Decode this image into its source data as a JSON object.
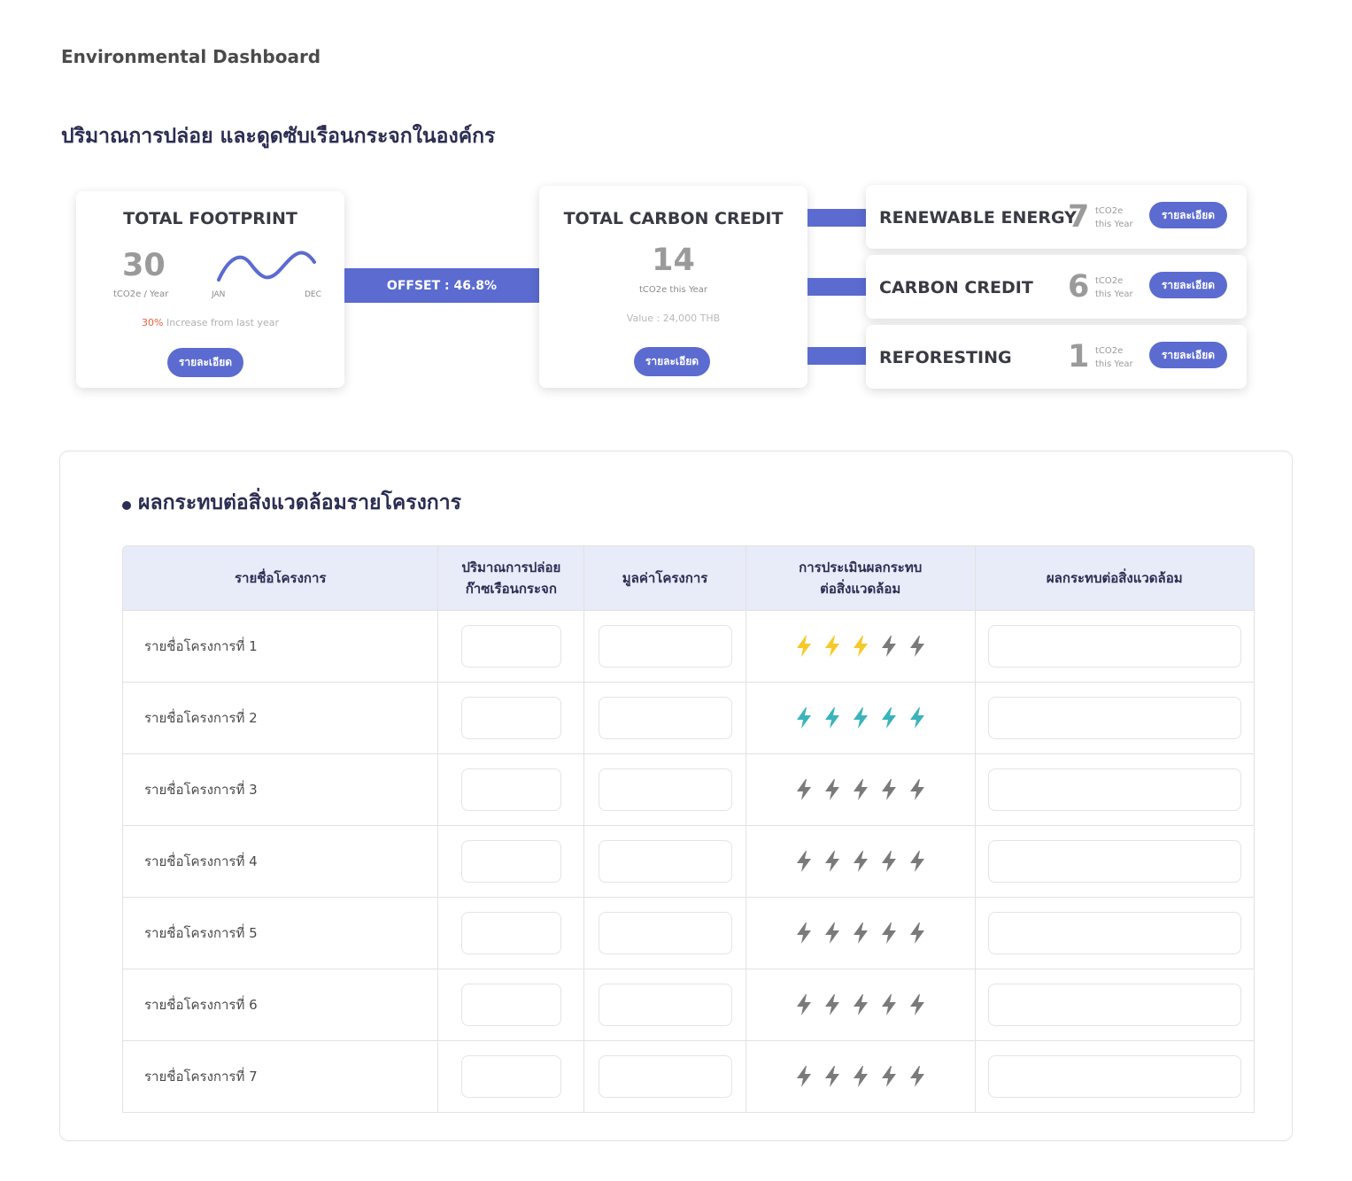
{
  "header": {
    "app_title": "Environmental Dashboard",
    "section_title": "ปริมาณการปล่อย และดูดซับเรือนกระจกในองค์กร"
  },
  "footprint": {
    "title": "TOTAL FOOTPRINT",
    "value": "30",
    "unit": "tCO2e / Year",
    "jan": "JAN",
    "dec": "DEC",
    "increase_pct": "30%",
    "increase_text": " Increase from last year",
    "button": "รายละเอียด"
  },
  "offset": {
    "label": "OFFSET : 46.8%"
  },
  "credit": {
    "title": "TOTAL CARBON CREDIT",
    "value": "14",
    "unit": "tCO2e this Year",
    "value_text": "Value : 24,000 THB",
    "button": "รายละเอียด"
  },
  "breakdown": [
    {
      "label": "RENEWABLE ENERGY",
      "value": "7",
      "unit_line1": "tCO2e",
      "unit_line2": "this Year",
      "button": "รายละเอียด"
    },
    {
      "label": "CARBON CREDIT",
      "value": "6",
      "unit_line1": "tCO2e",
      "unit_line2": "this Year",
      "button": "รายละเอียด"
    },
    {
      "label": "REFORESTING",
      "value": "1",
      "unit_line1": "tCO2e",
      "unit_line2": "this Year",
      "button": "รายละเอียด"
    }
  ],
  "impact": {
    "title": "ผลกระทบต่อสิ่งแวดล้อมรายโครงการ",
    "columns": [
      "รายชื่อโครงการ",
      "ปริมาณการปล่อย\nก๊าซเรือนกระจก",
      "มูลค่าโครงการ",
      "การประเมินผลกระทบ\nต่อสิ่งแวดล้อม",
      "ผลกระทบต่อสิ่งแวดล้อม"
    ],
    "rows": [
      {
        "name": "รายชื่อโครงการที่ 1",
        "rating": 3,
        "rating_color": "#f5c928"
      },
      {
        "name": "รายชื่อโครงการที่ 2",
        "rating": 5,
        "rating_color": "#3bb3ba"
      },
      {
        "name": "รายชื่อโครงการที่ 3",
        "rating": 0,
        "rating_color": "#f5c928"
      },
      {
        "name": "รายชื่อโครงการที่ 4",
        "rating": 0,
        "rating_color": "#f5c928"
      },
      {
        "name": "รายชื่อโครงการที่ 5",
        "rating": 0,
        "rating_color": "#f5c928"
      },
      {
        "name": "รายชื่อโครงการที่ 6",
        "rating": 0,
        "rating_color": "#f5c928"
      },
      {
        "name": "รายชื่อโครงการที่ 7",
        "rating": 0,
        "rating_color": "#f5c928"
      }
    ],
    "rating_max": 5,
    "rating_off_color": "#7a7a7a"
  },
  "colors": {
    "accent": "#5b6bd0",
    "header_bg": "#e8ebf8",
    "increase": "#e9613d"
  }
}
